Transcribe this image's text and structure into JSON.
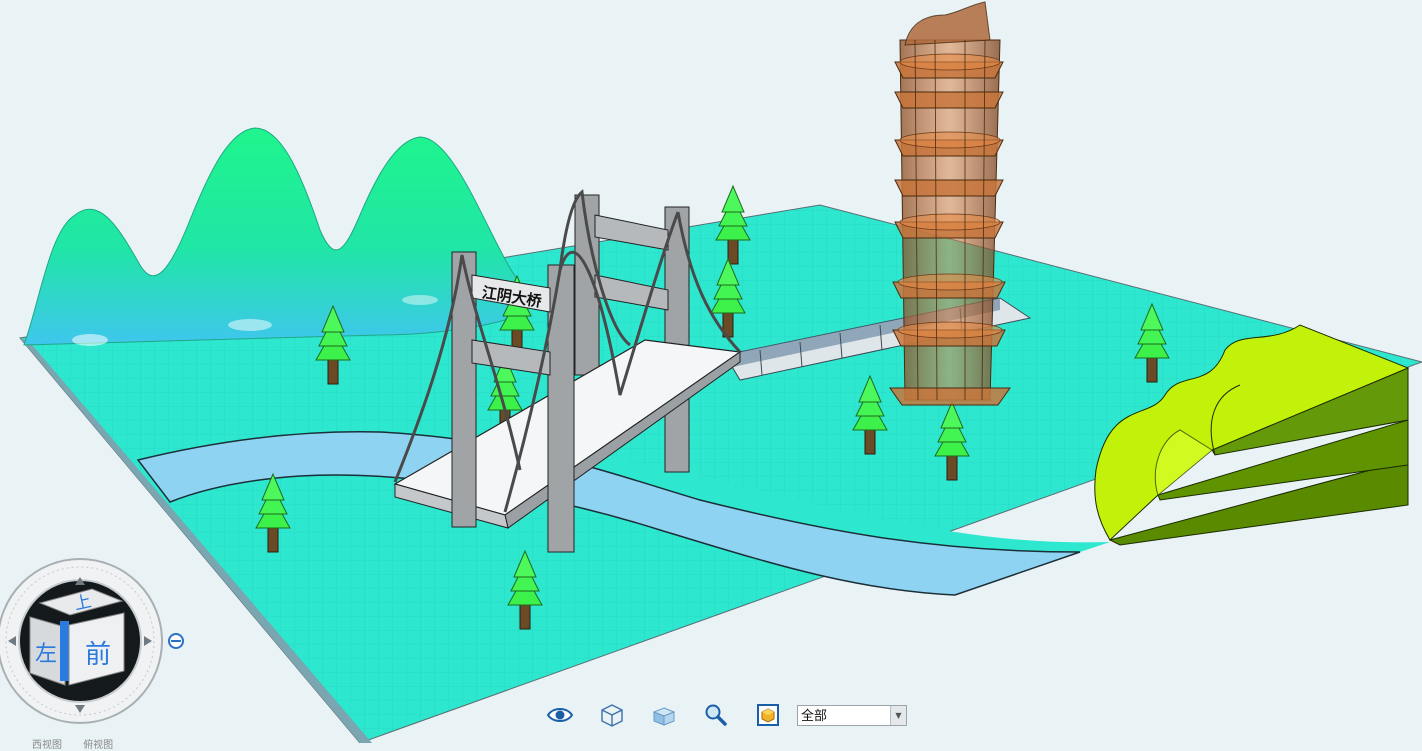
{
  "viewport": {
    "bridge_sign": "江阴大桥"
  },
  "view_cube": {
    "top_face": "上",
    "front_face": "前",
    "left_face": "左"
  },
  "toolbar": {
    "icons": [
      "eye-icon",
      "wireframe-cube-icon",
      "shaded-cube-icon",
      "zoom-icon",
      "render-icon"
    ],
    "filter_value": "全部"
  },
  "bottom_labels": [
    "西视图",
    "俯视图"
  ],
  "colors": {
    "background": "#e9f3f6",
    "ground": "#2de8cf",
    "river": "#8fd3f2",
    "mountains": "#22f09a",
    "terraces": "#c3f20a",
    "tree_foliage": "#3cf24a",
    "tower": "#c7703a",
    "bridge": "#a0a4a6"
  }
}
